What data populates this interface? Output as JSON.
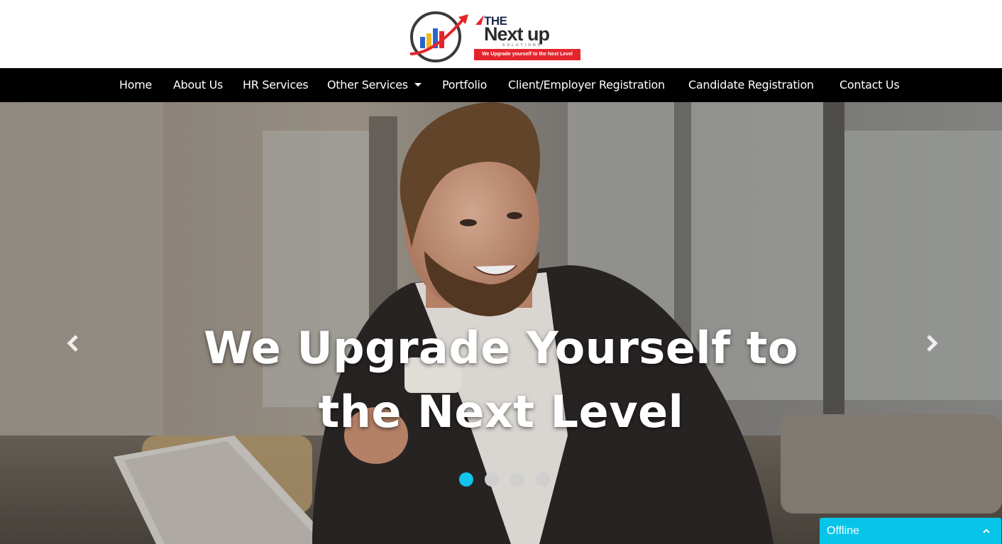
{
  "brand": {
    "logo_the": "THE",
    "logo_nextup": "Next up",
    "logo_solutions": "SOLUTIONS",
    "logo_tagline": "We Upgrade yourself to the Next Level",
    "logo_icon": "rising-bar-chart-arrow-icon",
    "colors": {
      "red": "#e4242b",
      "blue": "#2a64c8",
      "yellow": "#f2b51d",
      "dark": "#2b2b2b"
    }
  },
  "nav": {
    "items": [
      {
        "label": "Home"
      },
      {
        "label": "About Us"
      },
      {
        "label": "HR Services"
      },
      {
        "label": "Other Services",
        "has_dropdown": true
      },
      {
        "label": "Portfolio"
      },
      {
        "label": "Client/Employer Registration"
      },
      {
        "label": "Candidate Registration"
      },
      {
        "label": "Contact Us"
      }
    ],
    "background": "#000000",
    "text_color": "#ffffff"
  },
  "hero": {
    "title_line1": "We Upgrade Yourself to",
    "title_line2": "the Next Level",
    "prev_icon": "chevron-left-icon",
    "next_icon": "chevron-right-icon",
    "slides_total": 4,
    "active_slide": 1,
    "active_dot_color": "#12c3ea"
  },
  "chat_widget": {
    "status_label": "Offline",
    "icon": "chevron-up-icon",
    "color": "#06c4e8"
  }
}
